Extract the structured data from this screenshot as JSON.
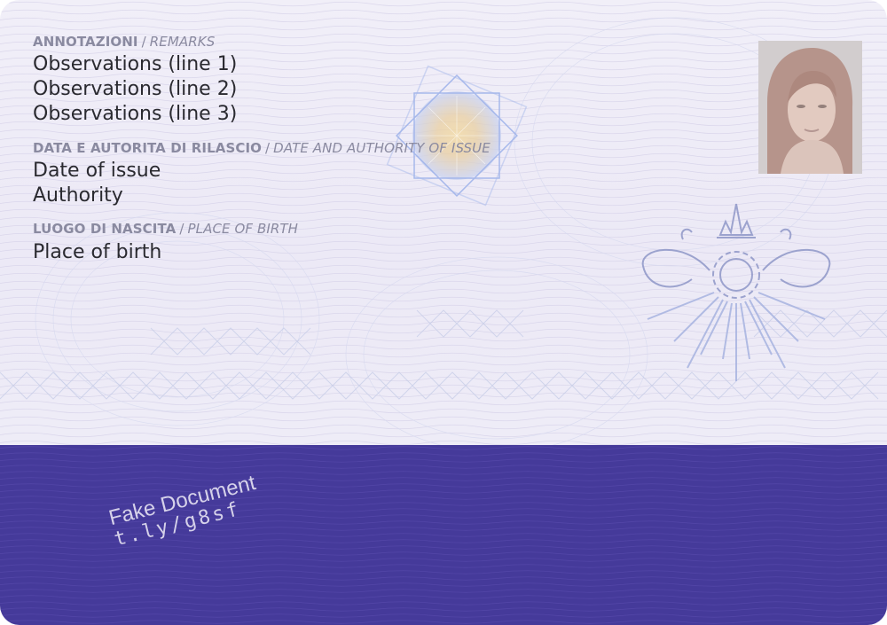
{
  "remarks": {
    "label_it": "ANNOTAZIONI",
    "separator": "/",
    "label_en": "REMARKS",
    "lines": [
      "Observations (line 1)",
      "Observations (line 2)",
      "Observations (line 3)"
    ]
  },
  "issue": {
    "label_it": "DATA E AUTORITA DI RILASCIO",
    "separator": "/",
    "label_en": "DATE AND AUTHORITY OF ISSUE",
    "date": "Date of issue",
    "authority": "Authority"
  },
  "birth": {
    "label_it": "LUOGO DI NASCITA",
    "separator": "/",
    "label_en": "PLACE OF BIRTH",
    "value": "Place of birth"
  },
  "watermark": {
    "line1": "Fake Document",
    "line2": "t.ly/g8sf"
  },
  "colors": {
    "band": "#453a9a",
    "label": "#8a8aa0",
    "value": "#2a2a30",
    "card_bg": "#eeecf7"
  }
}
